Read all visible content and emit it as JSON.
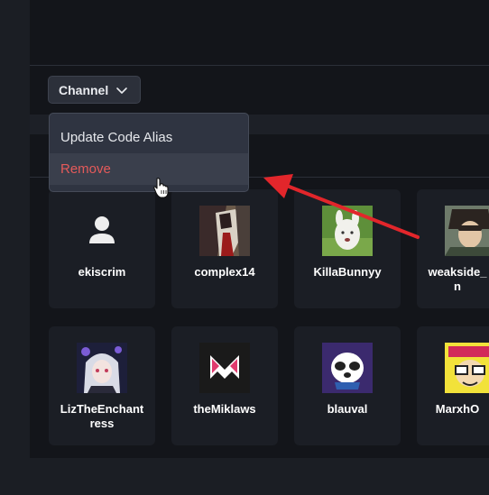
{
  "toolbar": {
    "channel_label": "Channel"
  },
  "menu": {
    "update_alias_label": "Update Code Alias",
    "remove_label": "Remove"
  },
  "cards": [
    {
      "name": "ekiscrim"
    },
    {
      "name": "complex14"
    },
    {
      "name": "KillaBunnyy"
    },
    {
      "name": "weakside_\nn"
    },
    {
      "name": "LizTheEnchant\nress"
    },
    {
      "name": "theMiklaws"
    },
    {
      "name": "blauval"
    },
    {
      "name": "MarxhO"
    }
  ],
  "icons": {
    "channel_dropdown": "chevron-down-icon",
    "default_avatar": "user-icon",
    "cursor": "hand-pointer-icon",
    "annotation": "red-arrow"
  },
  "colors": {
    "remove_text": "#e45a5a",
    "annotation_arrow": "#e2262b",
    "background": "#13151a"
  }
}
